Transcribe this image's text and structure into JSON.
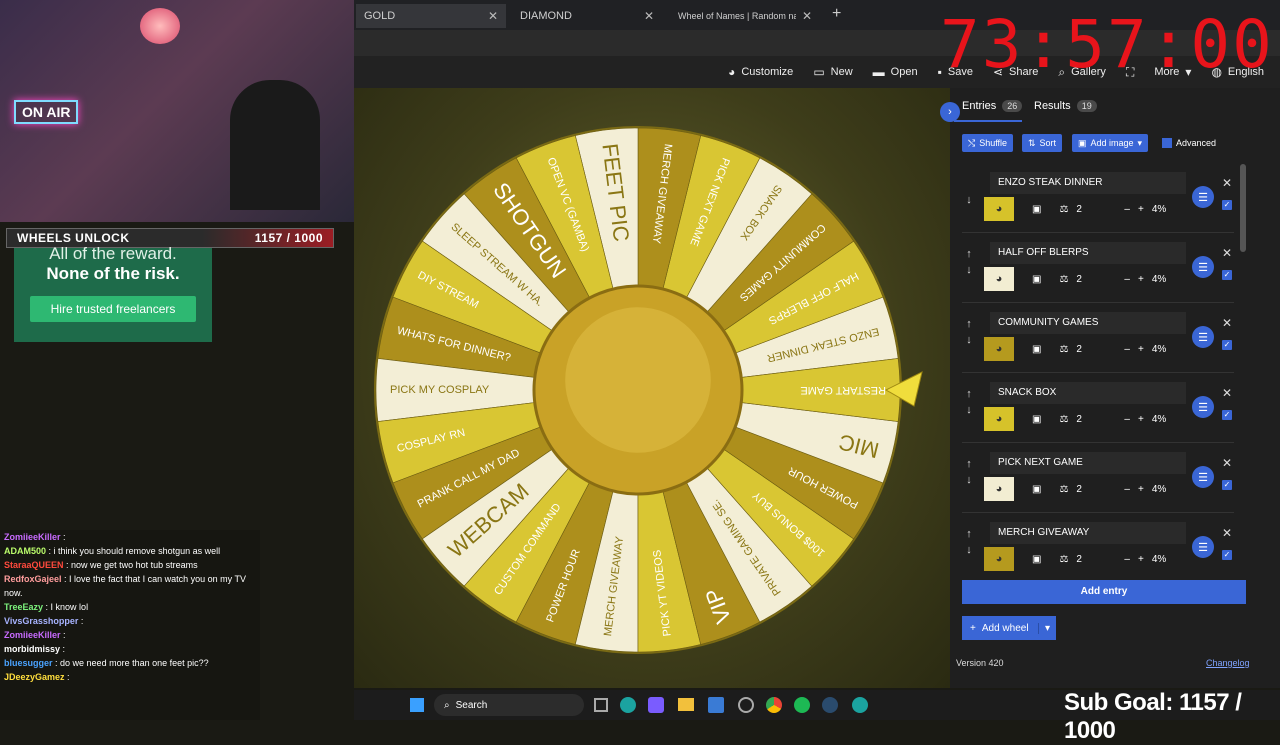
{
  "browser": {
    "tabs": [
      {
        "label": "GOLD",
        "active": true
      },
      {
        "label": "DIAMOND",
        "active": false
      },
      {
        "label": "Wheel of Names | Random name ...",
        "active": false
      }
    ]
  },
  "toolbar": {
    "customize": "Customize",
    "new": "New",
    "open": "Open",
    "save": "Save",
    "share": "Share",
    "gallery": "Gallery",
    "more": "More",
    "language": "English"
  },
  "sidebar": {
    "entries_tab": "Entries",
    "entries_count": "26",
    "results_tab": "Results",
    "results_count": "19",
    "shuffle": "Shuffle",
    "sort": "Sort",
    "add_image": "Add image",
    "advanced": "Advanced",
    "entries": [
      {
        "name": "ENZO STEAK DINNER",
        "weight": "2",
        "percent": "4%",
        "swatch": "#d6c22a"
      },
      {
        "name": "HALF OFF BLERPS",
        "weight": "2",
        "percent": "4%",
        "swatch": "#f2edd2"
      },
      {
        "name": "COMMUNITY GAMES",
        "weight": "2",
        "percent": "4%",
        "swatch": "#b59a1e"
      },
      {
        "name": "SNACK BOX",
        "weight": "2",
        "percent": "4%",
        "swatch": "#d6c22a"
      },
      {
        "name": "PICK NEXT GAME",
        "weight": "2",
        "percent": "4%",
        "swatch": "#f2edd2"
      },
      {
        "name": "MERCH GIVEAWAY",
        "weight": "2",
        "percent": "4%",
        "swatch": "#b59a1e"
      }
    ],
    "add_entry": "Add entry",
    "add_wheel": "Add wheel",
    "version": "Version 420",
    "changelog": "Changelog"
  },
  "wheel": {
    "slices": [
      "ENZO STEAK DINNER",
      "HALF OFF BLERPS",
      "COMMUNITY GAMES",
      "SNACK BOX",
      "PICK NEXT GAME",
      "MERCH GIVEAWAY",
      "FEET PIC",
      "OPEN VC (GAMBA)",
      "SHOTGUN",
      "SLEEP STREAM W HA.",
      "DIY STREAM",
      "WHATS FOR DINNER?",
      "PICK MY COSPLAY",
      "COSPLAY RN",
      "PRANK CALL MY DAD",
      "WEBCAM",
      "CUSTOM COMMAND",
      "POWER HOUR",
      "MERCH GIVEAWAY",
      "PICK YT VIDEOS",
      "VIP",
      "PRIVATE GAMING SE.",
      "100$ BONUS BUY",
      "POWER HOUR",
      "MIC",
      "RESTART GAME"
    ],
    "colors": [
      "#f3eed6",
      "#d9c633",
      "#ad8f1c"
    ]
  },
  "overlay": {
    "wheels_label": "WHEELS UNLOCK",
    "wheels_progress": "1157 / 1000",
    "on_air": "ON AIR",
    "ad_line1": "All of the reward.",
    "ad_line2": "None of the risk.",
    "ad_button": "Hire trusted freelancers",
    "timer": "73:57:00",
    "sub_goal": "Sub Goal: 1157 / 1000"
  },
  "chat": [
    {
      "user": "ZomiieeKiller",
      "color": "#c86bff",
      "text": ""
    },
    {
      "user": "ADAM500",
      "color": "#bafc6b",
      "text": "i think you should remove shotgun as well"
    },
    {
      "user": "StaraaQUEEN",
      "color": "#ff4a3d",
      "text": "now we get two hot tub streams"
    },
    {
      "user": "RedfoxGajeel",
      "color": "#ff9d9d",
      "text": "I love the fact that I can watch you on my TV now."
    },
    {
      "user": "TreeEazy",
      "color": "#7df37d",
      "text": "I know lol"
    },
    {
      "user": "VivsGrasshopper",
      "color": "#a7b3ff",
      "text": ""
    },
    {
      "user": "ZomiieeKiller",
      "color": "#c86bff",
      "text": ""
    },
    {
      "user": "morbidmissy",
      "color": "#ffffff",
      "text": ""
    },
    {
      "user": "bluesugger",
      "color": "#4aa3ff",
      "text": "do we need more than one feet pic??"
    },
    {
      "user": "JDeezyGamez",
      "color": "#ffde3d",
      "text": ""
    }
  ],
  "taskbar": {
    "search": "Search"
  }
}
